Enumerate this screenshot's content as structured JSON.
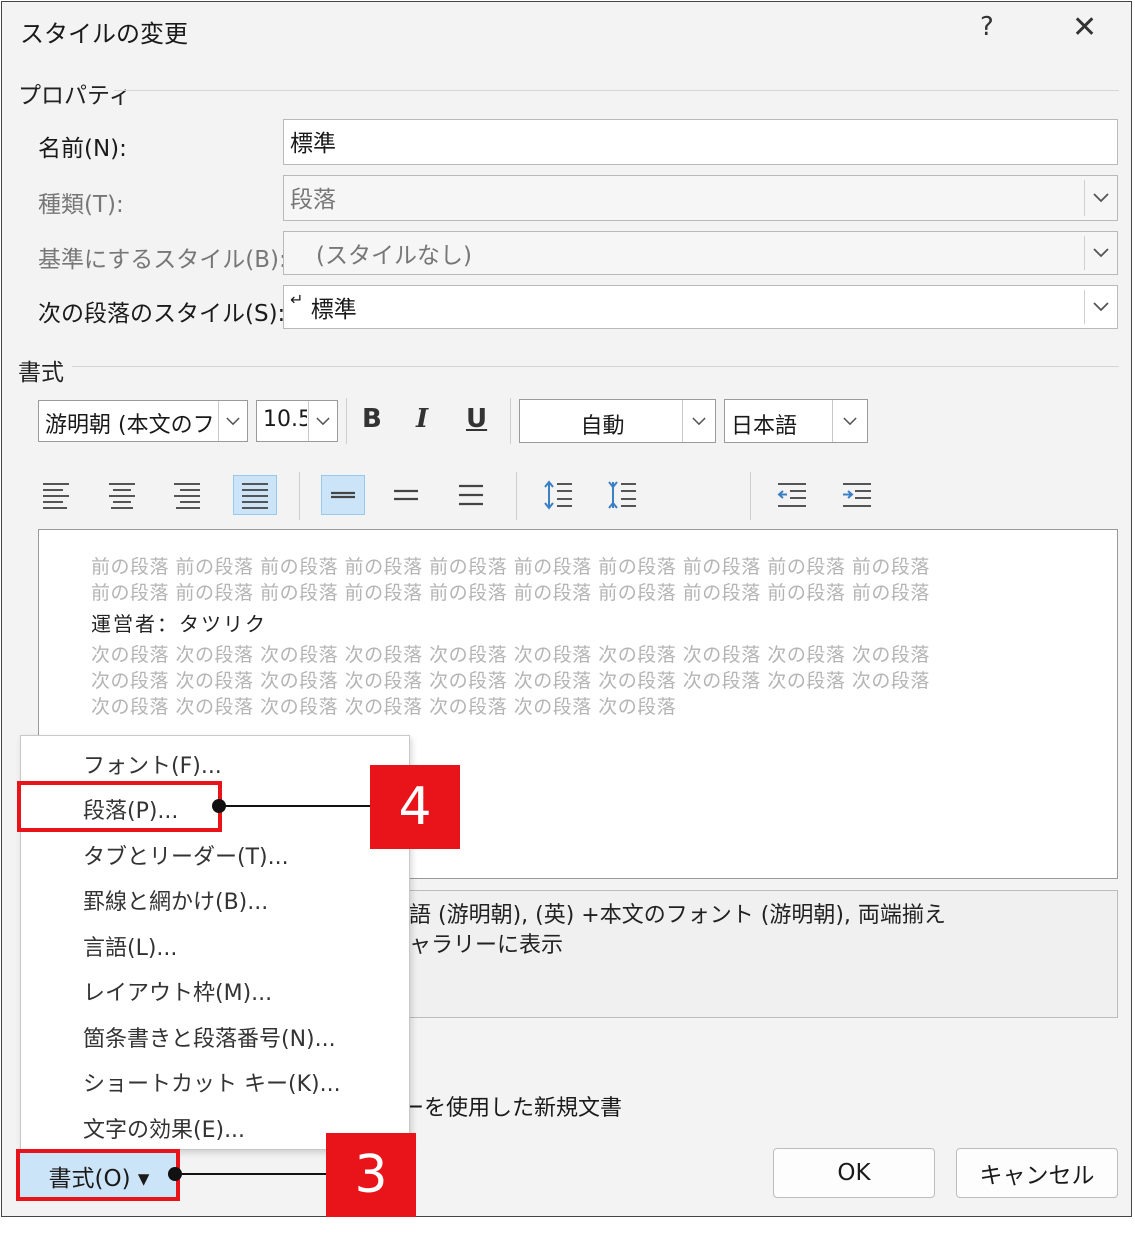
{
  "dialog": {
    "title": "スタイルの変更",
    "help": "?",
    "close": "✕"
  },
  "properties": {
    "group_label": "プロパティ",
    "name_label": "名前(N):",
    "name_value": "標準",
    "type_label": "種類(T):",
    "type_value": "段落",
    "based_label": "基準にするスタイル(B):",
    "based_value": "(スタイルなし)",
    "next_label": "次の段落のスタイル(S):",
    "next_value": "標準"
  },
  "format": {
    "group_label": "書式",
    "font": "游明朝 (本文のフ",
    "size": "10.5",
    "bold": "B",
    "italic": "I",
    "underline": "U",
    "color": "自動",
    "language": "日本語"
  },
  "preview": {
    "prev_lines": [
      "前の段落 前の段落 前の段落 前の段落 前の段落 前の段落 前の段落 前の段落 前の段落 前の段落",
      "前の段落 前の段落 前の段落 前の段落 前の段落 前の段落 前の段落 前の段落 前の段落 前の段落"
    ],
    "main_text": "運営者：タツリク",
    "next_lines": [
      "次の段落 次の段落 次の段落 次の段落 次の段落 次の段落 次の段落 次の段落 次の段落 次の段落",
      "次の段落 次の段落 次の段落 次の段落 次の段落 次の段落 次の段落 次の段落 次の段落 次の段落",
      "次の段落 次の段落 次の段落 次の段落 次の段落 次の段落 次の段落"
    ]
  },
  "description": {
    "line1": "語 (游明朝), (英) +本文のフォント (游明朝), 両端揃え",
    "line2": "ャラリーに表示"
  },
  "new_doc_text": "ーを使用した新規文書",
  "menu": {
    "items": [
      "フォント(F)...",
      "段落(P)...",
      "タブとリーダー(T)...",
      "罫線と網かけ(B)...",
      "言語(L)...",
      "レイアウト枠(M)...",
      "箇条書きと段落番号(N)...",
      "ショートカット キー(K)...",
      "文字の効果(E)..."
    ]
  },
  "buttons": {
    "format": "書式(O) ▾",
    "ok": "OK",
    "cancel": "キャンセル"
  },
  "callouts": {
    "step4": "4",
    "step3": "3"
  },
  "colors": {
    "accent_red": "#e8141a",
    "selected_blue": "#cce4f7"
  }
}
